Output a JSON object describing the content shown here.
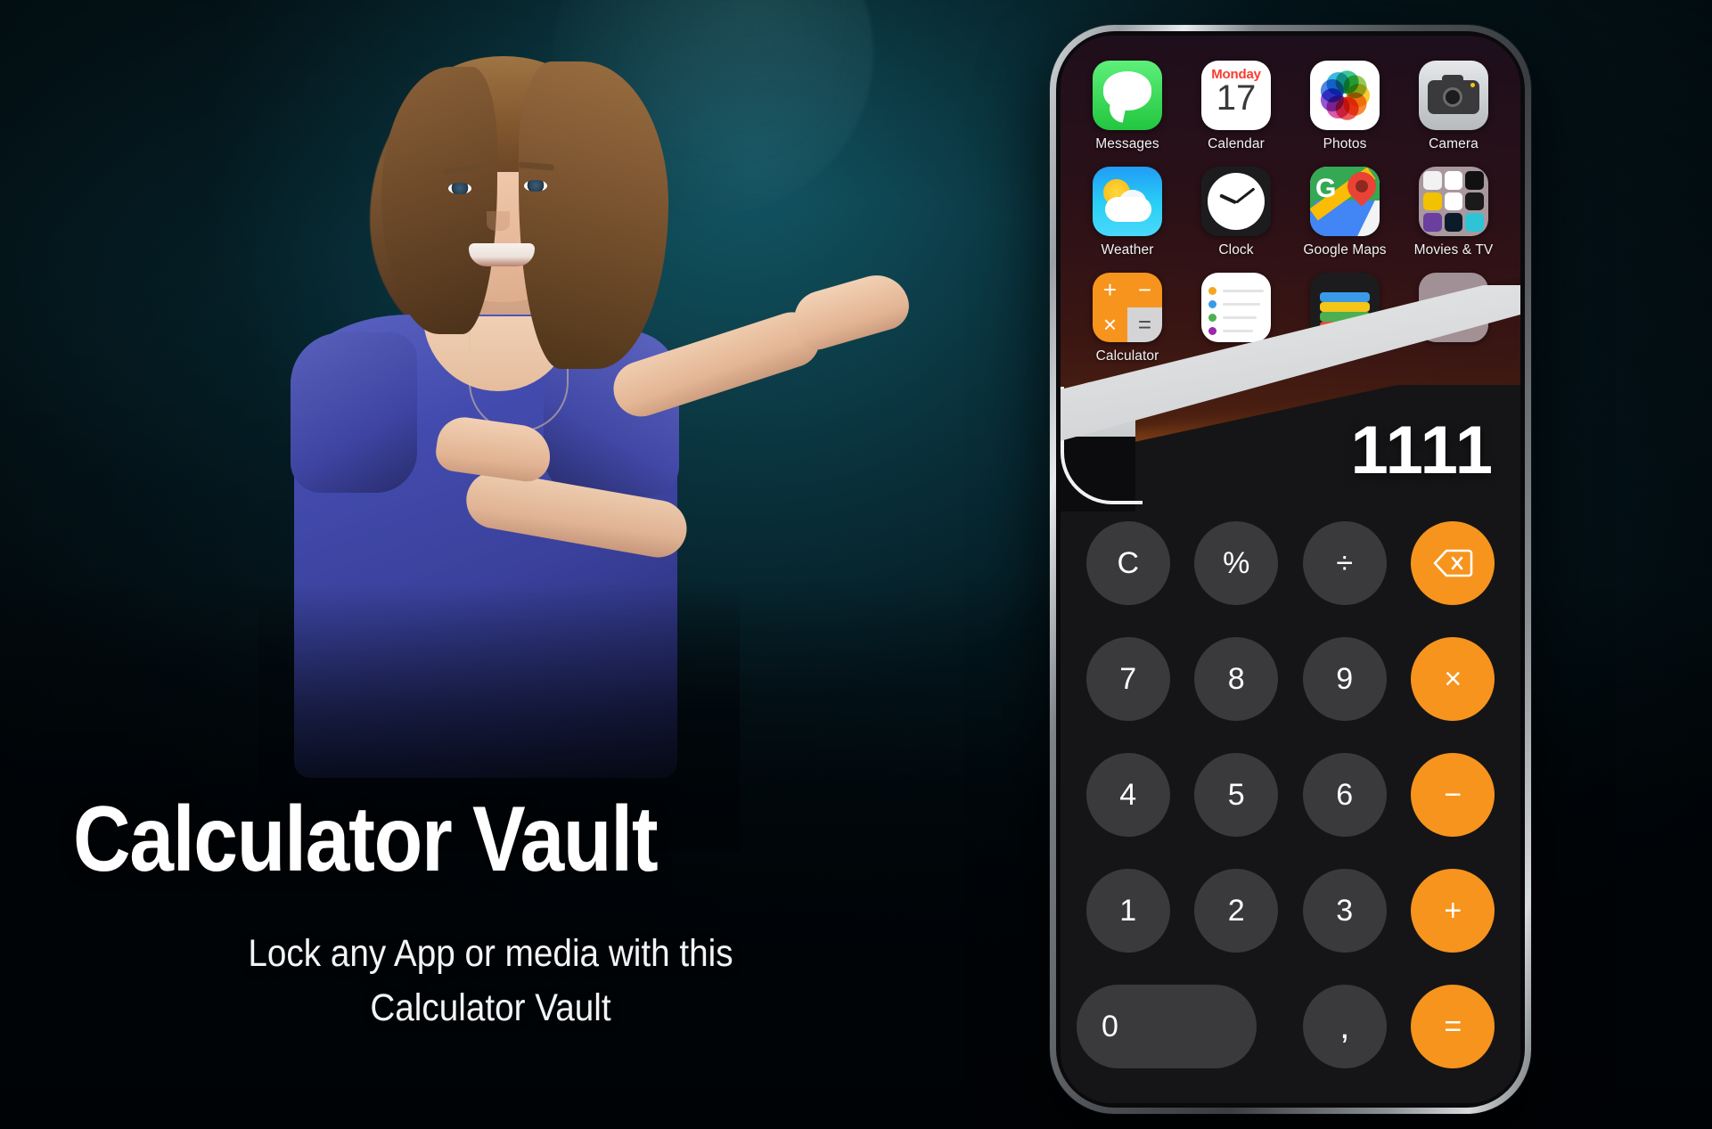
{
  "promo": {
    "title": "Calculator Vault",
    "subtitle_line1": "Lock any App or media with this",
    "subtitle_line2": "Calculator Vault"
  },
  "colors": {
    "accent_orange": "#f7941d",
    "key_gray": "#3a3a3c",
    "vault_bg": "#151517",
    "background_teal": "#0c3e4a",
    "background_dark": "#02070b",
    "shirt_blue": "#3a419c",
    "peel_paper": "#d4d6d8",
    "peel_cyan": "#1ec0f3"
  },
  "phone": {
    "home_screen": {
      "apps": [
        {
          "label": "Messages",
          "icon": "messages-icon"
        },
        {
          "label": "Calendar",
          "icon": "calendar-icon",
          "day": "Monday",
          "date": "17"
        },
        {
          "label": "Photos",
          "icon": "photos-icon"
        },
        {
          "label": "Camera",
          "icon": "camera-icon"
        },
        {
          "label": "Weather",
          "icon": "weather-icon"
        },
        {
          "label": "Clock",
          "icon": "clock-icon"
        },
        {
          "label": "Google Maps",
          "icon": "google-maps-icon",
          "glyph": "G"
        },
        {
          "label": "Movies & TV",
          "icon": "folder-icon"
        },
        {
          "label": "Calculator",
          "icon": "calculator-icon"
        },
        {
          "label": "",
          "icon": "notes-icon"
        },
        {
          "label": "",
          "icon": "wallet-icon"
        },
        {
          "label": "",
          "icon": "generic-app-icon"
        }
      ]
    },
    "calculator_vault": {
      "display_value": "1111",
      "keys": [
        {
          "label": "C",
          "name": "clear-key",
          "style": "gray"
        },
        {
          "label": "%",
          "name": "percent-key",
          "style": "gray"
        },
        {
          "label": "÷",
          "name": "divide-key",
          "style": "gray"
        },
        {
          "label": "",
          "name": "backspace-key",
          "style": "orange",
          "icon": "backspace-icon"
        },
        {
          "label": "7",
          "name": "digit-7-key",
          "style": "gray"
        },
        {
          "label": "8",
          "name": "digit-8-key",
          "style": "gray"
        },
        {
          "label": "9",
          "name": "digit-9-key",
          "style": "gray"
        },
        {
          "label": "×",
          "name": "multiply-key",
          "style": "orange"
        },
        {
          "label": "4",
          "name": "digit-4-key",
          "style": "gray"
        },
        {
          "label": "5",
          "name": "digit-5-key",
          "style": "gray"
        },
        {
          "label": "6",
          "name": "digit-6-key",
          "style": "gray"
        },
        {
          "label": "−",
          "name": "minus-key",
          "style": "orange"
        },
        {
          "label": "1",
          "name": "digit-1-key",
          "style": "gray"
        },
        {
          "label": "2",
          "name": "digit-2-key",
          "style": "gray"
        },
        {
          "label": "3",
          "name": "digit-3-key",
          "style": "gray"
        },
        {
          "label": "+",
          "name": "plus-key",
          "style": "orange"
        },
        {
          "label": "0",
          "name": "digit-0-key",
          "style": "gray-wide"
        },
        {
          "label": ",",
          "name": "comma-key",
          "style": "gray"
        },
        {
          "label": "=",
          "name": "equals-key",
          "style": "orange"
        }
      ]
    }
  },
  "calculator_app_icon": {
    "quadrants": [
      "+",
      "−",
      "×",
      "="
    ]
  }
}
